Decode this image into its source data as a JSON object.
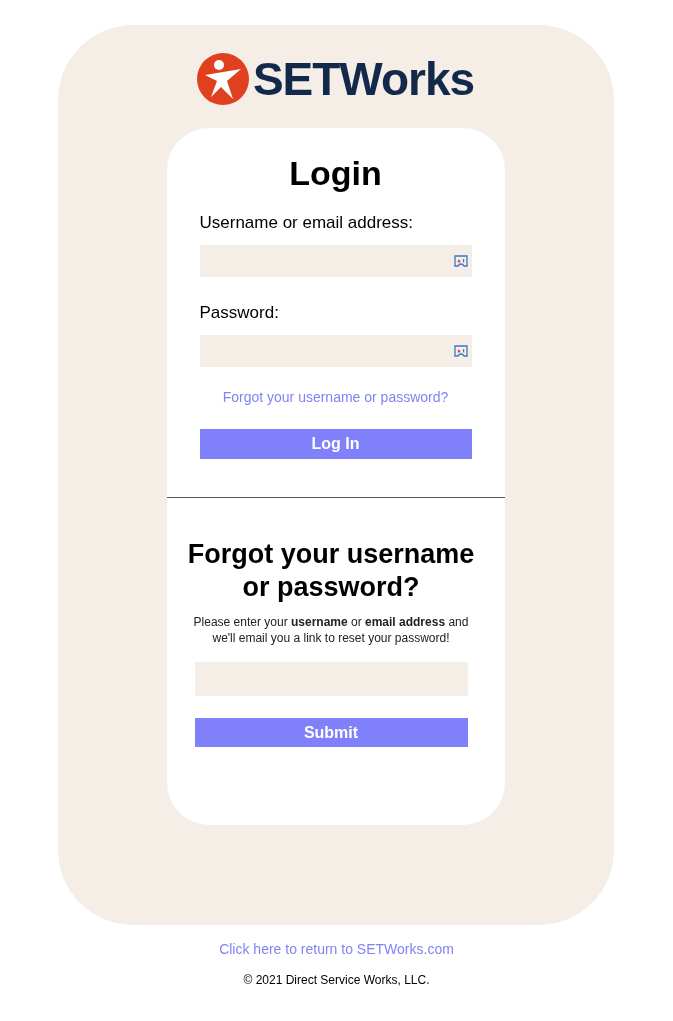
{
  "logo": {
    "text": "SETWorks"
  },
  "login": {
    "title": "Login",
    "fields": [
      {
        "label": "Username or email address:"
      },
      {
        "label": "Password:"
      }
    ],
    "forgot_link": "Forgot your username or password?",
    "button": "Log In"
  },
  "reset": {
    "title": "Forgot your username or password?",
    "instructions": "Please enter your **username** or **email address** and we'll email you a link to reset your password!",
    "button": "Submit"
  },
  "footer": {
    "link": "Click here to return to SETWorks.com",
    "copyright": "© 2021 Direct Service Works, LLC."
  }
}
